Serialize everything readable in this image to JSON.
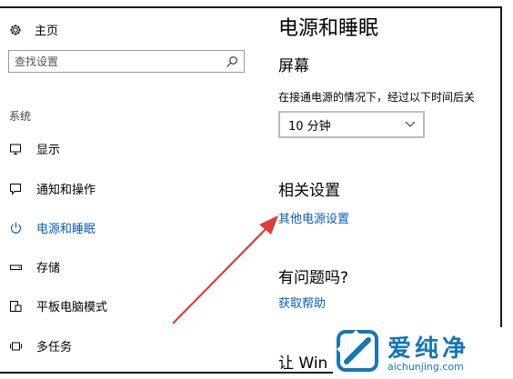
{
  "sidebar": {
    "home_label": "主页",
    "search_placeholder": "查找设置",
    "section_label": "系统",
    "items": [
      {
        "label": "显示",
        "icon": "monitor-icon"
      },
      {
        "label": "通知和操作",
        "icon": "notification-icon"
      },
      {
        "label": "电源和睡眠",
        "icon": "power-icon",
        "active": true
      },
      {
        "label": "存储",
        "icon": "storage-icon"
      },
      {
        "label": "平板电脑模式",
        "icon": "tablet-mode-icon"
      },
      {
        "label": "多任务",
        "icon": "multitasking-icon"
      }
    ]
  },
  "main": {
    "title": "电源和睡眠",
    "screen_heading": "屏幕",
    "screen_description": "在接通电源的情况下，经过以下时间后关",
    "screen_timeout_value": "10 分钟",
    "related_heading": "相关设置",
    "related_link": "其他电源设置",
    "help_heading": "有问题吗?",
    "help_link": "获取帮助",
    "windows_heading": "让 Win"
  },
  "watermark": {
    "title": "爱纯净",
    "url": "aichunjing.com"
  },
  "colors": {
    "accent": "#0a5bc4",
    "annotation_arrow": "#e03a3a",
    "watermark": "#1576b8"
  }
}
